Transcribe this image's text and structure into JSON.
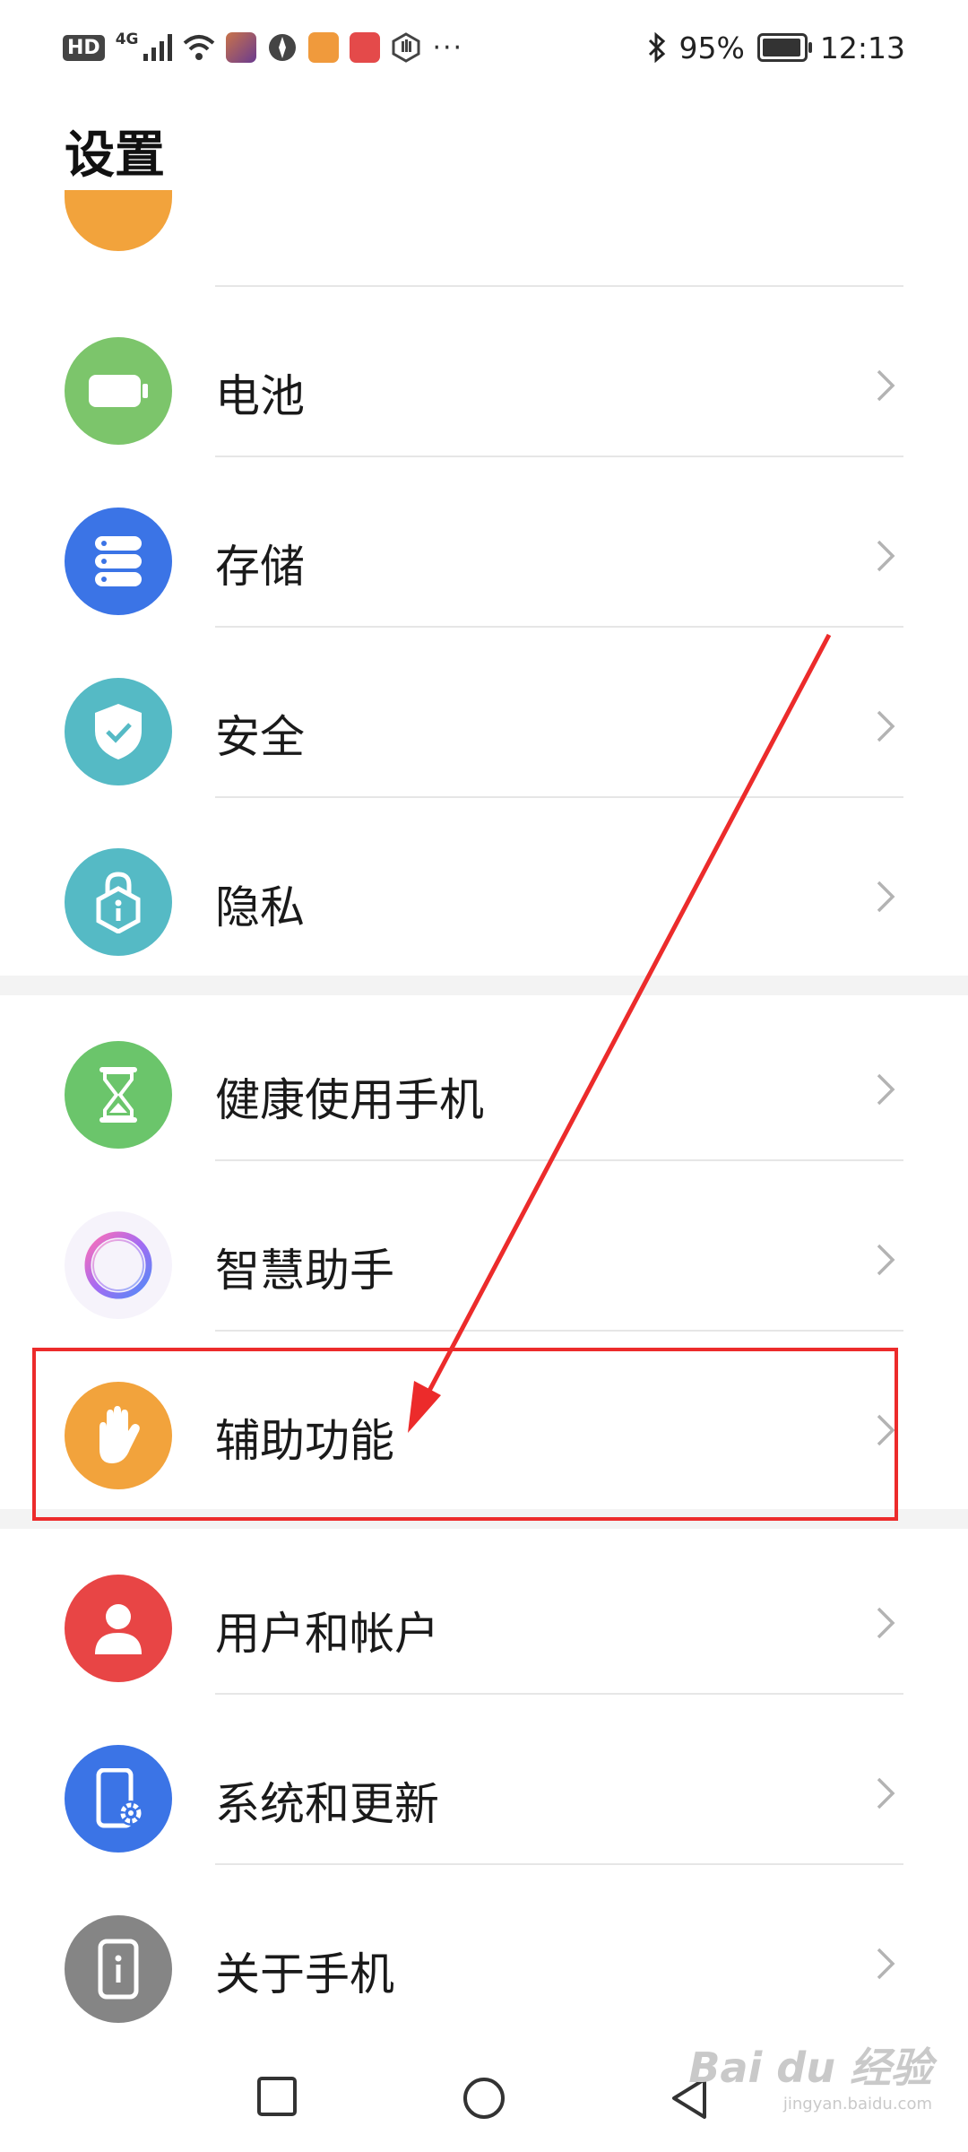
{
  "status_bar": {
    "hd": "HD",
    "network": "4G",
    "more": "···",
    "battery_percent": "95%",
    "battery_level": 0.95,
    "time": "12:13"
  },
  "page": {
    "title": "设置"
  },
  "settings": [
    {
      "key": "battery",
      "label": "电池",
      "icon": "battery-icon",
      "color": "#7cc56b"
    },
    {
      "key": "storage",
      "label": "存储",
      "icon": "storage-icon",
      "color": "#3b74e6"
    },
    {
      "key": "security",
      "label": "安全",
      "icon": "shield-icon",
      "color": "#55bac5"
    },
    {
      "key": "privacy",
      "label": "隐私",
      "icon": "privacy-lock-icon",
      "color": "#55bac5"
    },
    {
      "key": "digital-balance",
      "label": "健康使用手机",
      "icon": "hourglass-icon",
      "color": "#6bc56b"
    },
    {
      "key": "smart-assistant",
      "label": "智慧助手",
      "icon": "assistant-ring-icon",
      "color": "#b67cf0"
    },
    {
      "key": "accessibility",
      "label": "辅助功能",
      "icon": "hand-icon",
      "color": "#f2a33c"
    },
    {
      "key": "users-accounts",
      "label": "用户和帐户",
      "icon": "user-icon",
      "color": "#e84545"
    },
    {
      "key": "system-updates",
      "label": "系统和更新",
      "icon": "phone-settings-icon",
      "color": "#3b74e6"
    },
    {
      "key": "about-phone",
      "label": "关于手机",
      "icon": "info-phone-icon",
      "color": "#858585"
    }
  ],
  "annotation": {
    "highlight_color": "#ec2b2b"
  },
  "watermark": {
    "main": "Bai du 经验",
    "sub": "jingyan.baidu.com"
  }
}
